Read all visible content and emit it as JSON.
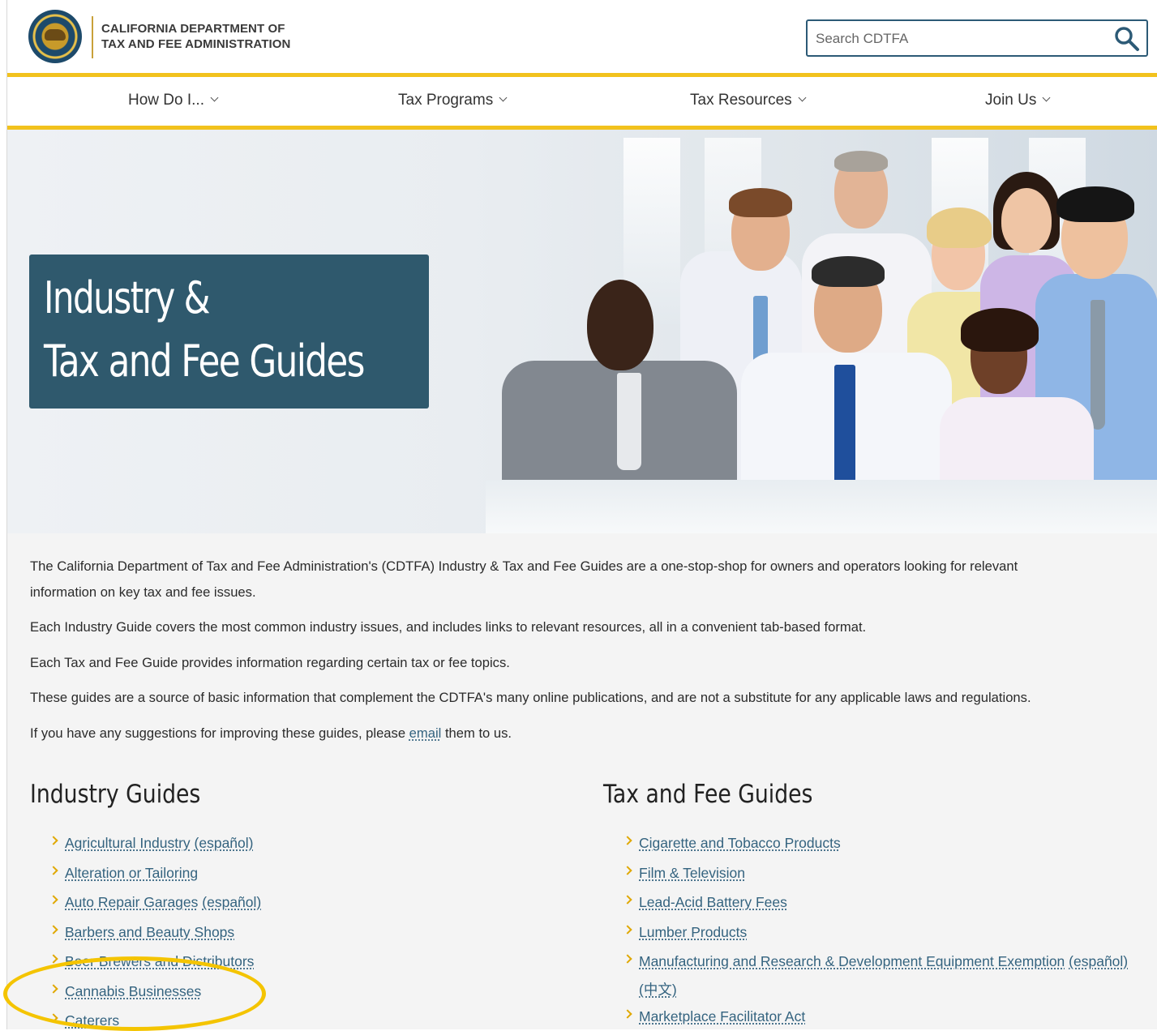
{
  "header": {
    "logo_line1": "CALIFORNIA DEPARTMENT OF",
    "logo_line2": "TAX AND FEE ADMINISTRATION",
    "search_placeholder": "Search CDTFA"
  },
  "nav": [
    {
      "label": "How Do I..."
    },
    {
      "label": "Tax Programs"
    },
    {
      "label": "Tax Resources"
    },
    {
      "label": "Join Us"
    }
  ],
  "hero": {
    "title_line1": "Industry &",
    "title_line2": "Tax and Fee Guides"
  },
  "intro": {
    "p1_line1": "The California Department of Tax and Fee Administration's (CDTFA) Industry & Tax and Fee Guides are a one-stop-shop for owners and operators looking for relevant",
    "p1_line2": "information on key tax and fee issues.",
    "p2": "Each Industry Guide covers the most common industry issues, and includes links to relevant resources, all in a convenient tab-based format.",
    "p3": "Each Tax and Fee Guide provides information regarding certain tax or fee topics.",
    "p4": "These guides are a source of basic information that complement the CDTFA's many online publications, and are not a substitute for any applicable laws and regulations.",
    "p5_before": "If you have any suggestions for improving these guides, please ",
    "p5_link": "email",
    "p5_after": " them to us."
  },
  "industry_guides": {
    "title": "Industry Guides",
    "items": [
      {
        "label": "Agricultural Industry",
        "extra": "(español)"
      },
      {
        "label": "Alteration or Tailoring"
      },
      {
        "label": "Auto Repair Garages",
        "extra": "(español)"
      },
      {
        "label": "Barbers and Beauty Shops"
      },
      {
        "label": "Beer Brewers and Distributors"
      },
      {
        "label": "Cannabis Businesses"
      },
      {
        "label": "Caterers"
      }
    ]
  },
  "tax_fee_guides": {
    "title": "Tax and Fee Guides",
    "items": [
      {
        "label": "Cigarette and Tobacco Products"
      },
      {
        "label": "Film & Television"
      },
      {
        "label": "Lead-Acid Battery Fees"
      },
      {
        "label": "Lumber Products"
      },
      {
        "label": "Manufacturing and Research & Development Equipment Exemption",
        "extra": "(español)",
        "extra2": "(中文)"
      },
      {
        "label": "Marketplace Facilitator Act"
      }
    ]
  },
  "colors": {
    "accent_yellow": "#f2c21d",
    "brand_blue": "#2f596d",
    "link": "#34637f",
    "highlight_circle": "#f4c400"
  }
}
